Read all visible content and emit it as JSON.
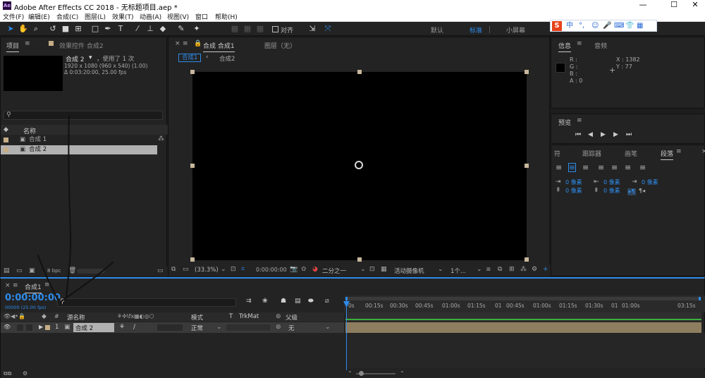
{
  "window": {
    "title": "Adobe After Effects CC 2018 - 无标题项目.aep *",
    "app_icon_text": "Ae",
    "minimize": "—",
    "maximize": "☐",
    "close": "✕"
  },
  "menu": [
    "文件(F)",
    "编辑(E)",
    "合成(C)",
    "图层(L)",
    "效果(T)",
    "动画(A)",
    "视图(V)",
    "窗口",
    "帮助(H)"
  ],
  "toolbar": {
    "align_label": "对齐",
    "workspaces": [
      "默认",
      "标准",
      "小屏幕"
    ],
    "active_workspace": "标准"
  },
  "ime": {
    "logo": "S",
    "lang": "中",
    "punct": "°,"
  },
  "project_panel": {
    "tab_project": "项目",
    "tab_effects": "效果控件 合成2",
    "comp_name": "合成 2",
    "used_text": "，使用了 1 次",
    "dims": "1920 x 1080 (960 x 540) (1.00)",
    "duration": "Δ 0:03:20:00, 25.00 fps",
    "search_placeholder": "",
    "col_name": "名称",
    "items": [
      {
        "name": "合成 1",
        "selected": false
      },
      {
        "name": "合成 2",
        "selected": true
      }
    ],
    "bpc": "8 bpc"
  },
  "comp_panel": {
    "tab_comp": "合成 合成1",
    "tab_layer": "图层（无）",
    "subtabs": [
      "合成1",
      "合成2"
    ],
    "zoom": "(33.3%)",
    "timecode": "0:00:00:00",
    "resolution": "二分之一",
    "camera": "活动摄像机",
    "views": "1个..."
  },
  "info_panel": {
    "tab_info": "信息",
    "tab_audio": "音频",
    "r": "R :",
    "g": "G :",
    "b": "B :",
    "a": "A : 0",
    "x": "X : 1382",
    "y": "Y : 77"
  },
  "preview_panel": {
    "title": "预览"
  },
  "para_panel": {
    "tabs": [
      "符",
      "跟踪器",
      "画笔",
      "段落"
    ],
    "active": "段落",
    "indent_values": [
      "0 像素",
      "0 像素",
      "0 像素",
      "0 像素",
      "0 像素",
      "0 像素"
    ]
  },
  "timeline": {
    "tab": "合成1",
    "time": "0:00:00:00",
    "frame_info": "00000 (25.00 fps)",
    "cols": {
      "source_name": "源名称",
      "mode": "模式",
      "t": "T",
      "trkmat": "TrkMat",
      "parent": "父级"
    },
    "layer": {
      "num": "1",
      "name": "合成 2",
      "mode": "正常",
      "parent": "无"
    },
    "ruler": [
      "0s",
      "00:15s",
      "00:30s",
      "00:45s",
      "01:00s",
      "01:15s",
      "01",
      "00:45s",
      "01:00s",
      "01:15s",
      "01:30s",
      "01",
      "01:00s",
      "03:15s"
    ]
  }
}
